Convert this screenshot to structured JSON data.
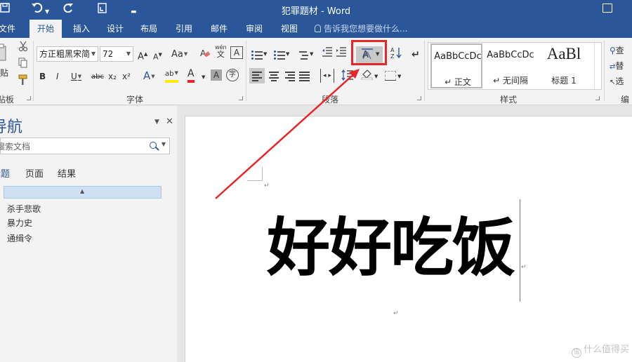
{
  "titlebar": {
    "title": "犯罪题材 - Word",
    "save_icon": "save-icon",
    "undo_icon": "undo-icon",
    "redo_icon": "redo-icon",
    "touch_icon": "touch-mode-icon",
    "customize_icon": "customize-toolbar-icon",
    "window_icon": "ribbon-display-options-icon"
  },
  "tabs": {
    "items": [
      "文件",
      "开始",
      "插入",
      "设计",
      "布局",
      "引用",
      "邮件",
      "审阅",
      "视图"
    ],
    "active": "开始",
    "tellme": "告诉我您想要做什么..."
  },
  "ribbon": {
    "clipboard": {
      "paste_label": "贴",
      "group_label": "贴板"
    },
    "font": {
      "font_name": "方正粗黑宋简",
      "font_size": "72",
      "grow": "A",
      "shrink": "A",
      "change_case": "Aa",
      "clear_format_icon": "clear-formatting-icon",
      "phonetic": "wén",
      "char_border": "A",
      "bold": "B",
      "italic": "I",
      "underline": "U",
      "strike": "abc",
      "subscript": "x₂",
      "superscript": "x²",
      "text_effects": "A",
      "highlight": "ab",
      "font_color": "A",
      "char_shading": "A",
      "enclose": "字",
      "group_label": "字体"
    },
    "paragraph": {
      "sort": "A↓",
      "show_marks": "↵",
      "asian_layout_label": "文",
      "group_label": "段落"
    },
    "styles": {
      "items": [
        {
          "sample": "AaBbCcDc",
          "name": "↵ 正文"
        },
        {
          "sample": "AaBbCcDc",
          "name": "↵ 无间隔"
        },
        {
          "sample": "AaBl",
          "name": "标题 1"
        }
      ],
      "group_label": "样式"
    },
    "editing": {
      "find": "查",
      "replace": "替",
      "select": "选",
      "group_label": "编"
    },
    "accent_color": "#2b579a",
    "highlight_color": "#e8262a"
  },
  "nav": {
    "title": "导航",
    "search_placeholder": "搜索文档",
    "tabs": [
      "标题",
      "页面",
      "结果"
    ],
    "active_tab": "标题",
    "items": [
      "杀手悲歌",
      "暴力史",
      "通缉令"
    ]
  },
  "document": {
    "text": "好好吃饭",
    "para_mark": "↵"
  },
  "watermark": {
    "text": "什么值得买"
  }
}
